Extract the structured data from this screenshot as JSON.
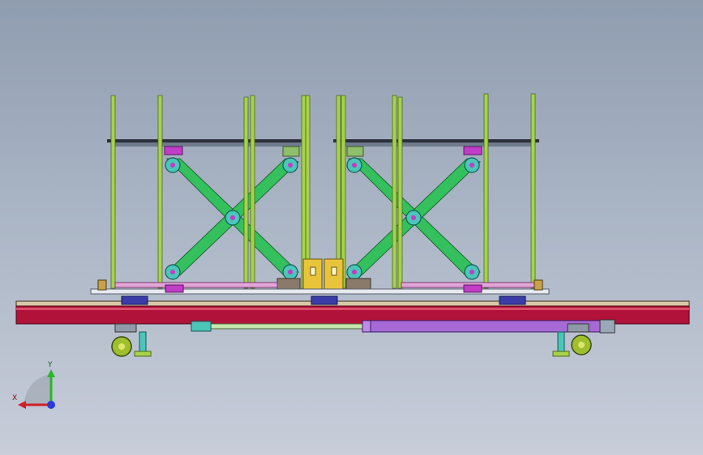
{
  "viewport": {
    "background_top": "#8f9db0",
    "background_bottom": "#c8cdd9"
  },
  "model": {
    "colors": {
      "frame_red": "#b0123a",
      "rod_green": "#a6d34a",
      "scissor_green": "#35c05e",
      "bearing_teal": "#4bc6b8",
      "bracket_magenta": "#c23cc8",
      "block_yellow": "#e8c43a",
      "cylinder_purple": "#a66ad6",
      "platform_dark": "#2b2f3a",
      "wheel_olive": "#9fbf2e"
    }
  },
  "triad": {
    "x_label": "X",
    "y_label": "Y",
    "x_color": "#d0202a",
    "y_color": "#2ab52a",
    "z_color": "#2a3bd6"
  }
}
